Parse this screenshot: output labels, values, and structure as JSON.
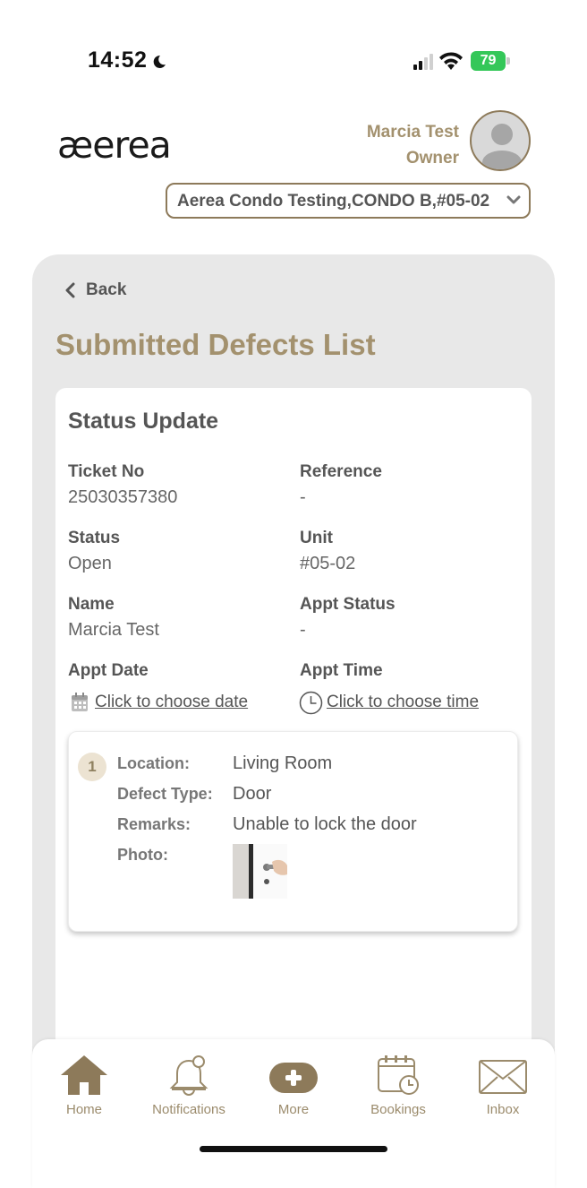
{
  "status_bar": {
    "time": "14:52",
    "battery": "79"
  },
  "header": {
    "logo": "æerea",
    "user_name": "Marcia Test",
    "user_role": "Owner",
    "unit_selector": "Aerea Condo Testing,CONDO B,#05-02"
  },
  "nav": {
    "back_label": "Back"
  },
  "page_title": "Submitted Defects List",
  "card": {
    "title": "Status Update",
    "ticket_no_label": "Ticket No",
    "ticket_no": "25030357380",
    "reference_label": "Reference",
    "reference": "-",
    "status_label": "Status",
    "status": "Open",
    "unit_label": "Unit",
    "unit": "#05-02",
    "name_label": "Name",
    "name": "Marcia Test",
    "appt_status_label": "Appt Status",
    "appt_status": "-",
    "appt_date_label": "Appt Date",
    "appt_date_link": "Click to choose date",
    "appt_time_label": "Appt Time",
    "appt_time_link": "Click to choose time"
  },
  "defect_item": {
    "number": "1",
    "location_label": "Location:",
    "location": "Living Room",
    "defect_type_label": "Defect Type:",
    "defect_type": "Door",
    "remarks_label": "Remarks:",
    "remarks": "Unable to lock the door",
    "photo_label": "Photo:"
  },
  "tabs": [
    {
      "label": "Home",
      "icon": "home-icon"
    },
    {
      "label": "Notifications",
      "icon": "bell-icon"
    },
    {
      "label": "More",
      "icon": "plus-icon"
    },
    {
      "label": "Bookings",
      "icon": "calendar-clock-icon"
    },
    {
      "label": "Inbox",
      "icon": "envelope-icon"
    }
  ],
  "colors": {
    "brand": "#a3916e",
    "brand_dark": "#8d7a5a",
    "panel": "#e8e8e8",
    "battery": "#34c759"
  }
}
